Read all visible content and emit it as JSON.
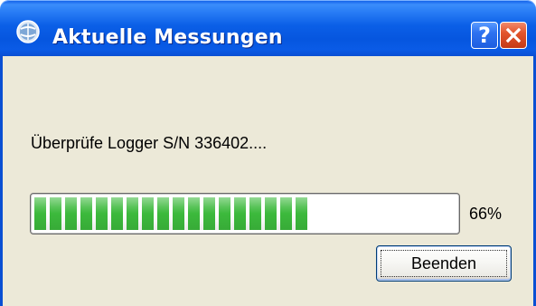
{
  "window": {
    "title": "Aktuelle Messungen",
    "icon": "logger-globe-icon",
    "help_label": "?",
    "close_icon": "close-icon"
  },
  "status": {
    "message": "Überprüfe Logger S/N 336402...."
  },
  "progress": {
    "value_percent": 66,
    "label": "66%",
    "color": "#3cb93c"
  },
  "buttons": {
    "end_label": "Beenden"
  },
  "colors": {
    "titlebar": "#0a5be6",
    "dialog_bg": "#ece9d8",
    "close_button": "#e3552c"
  }
}
